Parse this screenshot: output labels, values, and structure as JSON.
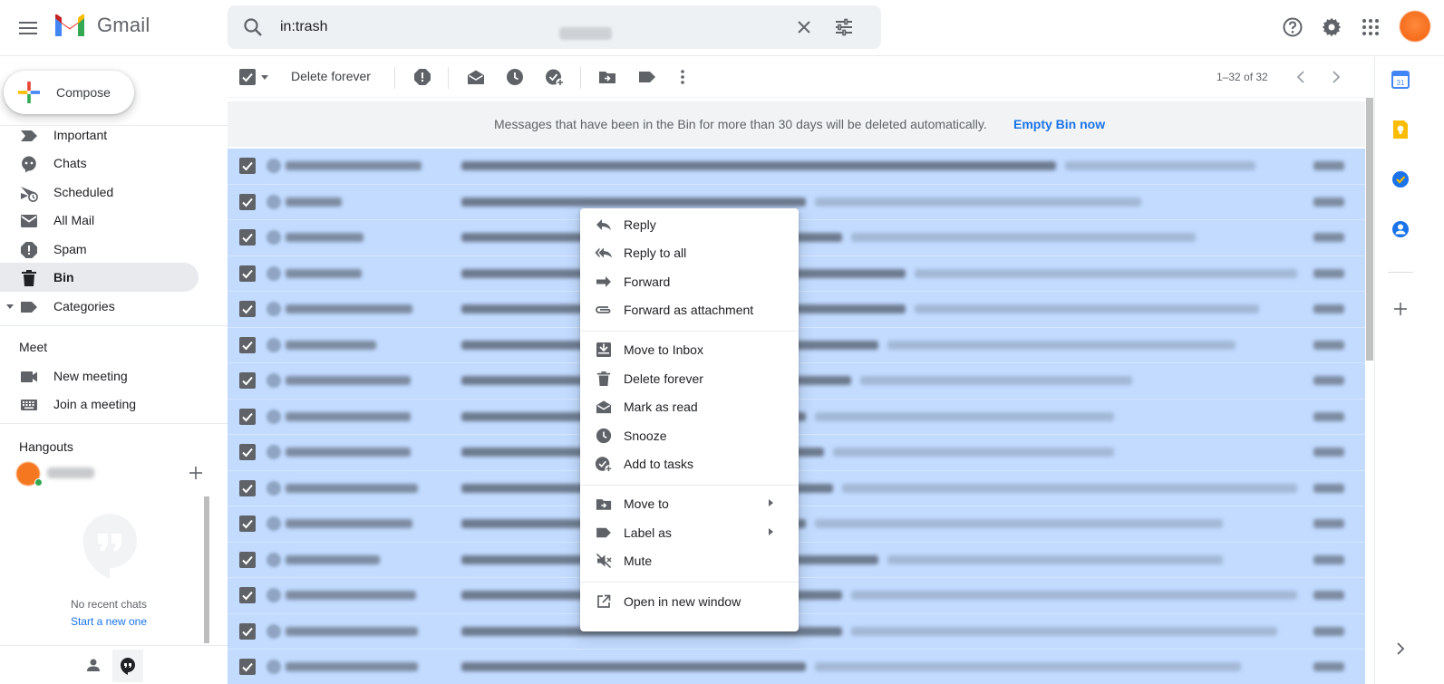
{
  "header": {
    "app_name": "Gmail",
    "search_value": "in:trash"
  },
  "sidebar": {
    "compose_label": "Compose",
    "items": [
      {
        "label": "Important"
      },
      {
        "label": "Chats"
      },
      {
        "label": "Scheduled"
      },
      {
        "label": "All Mail"
      },
      {
        "label": "Spam"
      },
      {
        "label": "Bin",
        "active": true
      },
      {
        "label": "Categories"
      }
    ],
    "meet": {
      "title": "Meet",
      "new_meeting": "New meeting",
      "join_meeting": "Join a meeting"
    },
    "hangouts": {
      "title": "Hangouts",
      "no_recent": "No recent chats",
      "start_new": "Start a new one"
    }
  },
  "toolbar": {
    "delete_forever": "Delete forever",
    "page_count": "1–32 of 32"
  },
  "banner": {
    "text": "Messages that have been in the Bin for more than 30 days will be deleted automatically.",
    "action": "Empty Bin now"
  },
  "context_menu": {
    "items": [
      {
        "label": "Reply"
      },
      {
        "label": "Reply to all"
      },
      {
        "label": "Forward"
      },
      {
        "label": "Forward as attachment"
      },
      {
        "label": "Move to Inbox"
      },
      {
        "label": "Delete forever"
      },
      {
        "label": "Mark as read"
      },
      {
        "label": "Snooze"
      },
      {
        "label": "Add to tasks"
      },
      {
        "label": "Move to"
      },
      {
        "label": "Label as"
      },
      {
        "label": "Mute"
      },
      {
        "label": "Open in new window"
      }
    ]
  },
  "colors": {
    "selected_row": "#c2dbff",
    "accent_blue": "#1a73e8",
    "active_nav": "#e8eaed"
  }
}
